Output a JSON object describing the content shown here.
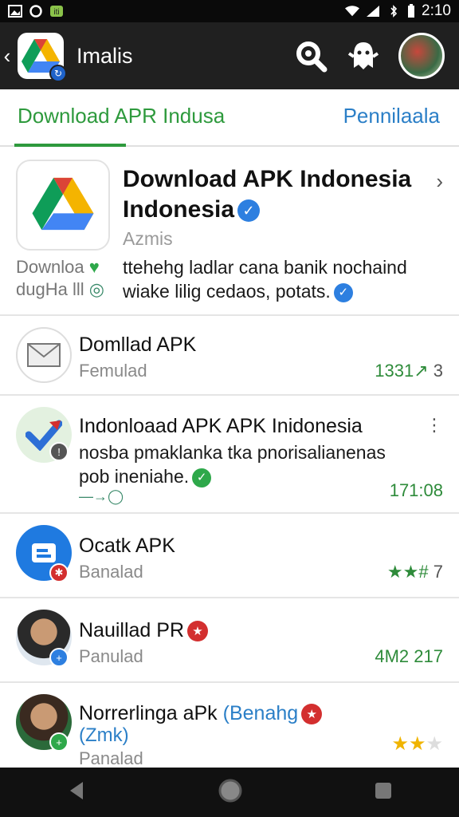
{
  "status": {
    "time": "2:10",
    "left_icons": [
      "image-icon",
      "data-saver-icon",
      "app-badge-icon"
    ],
    "right_icons": [
      "wifi-icon",
      "signal-icon",
      "bluetooth-icon",
      "battery-icon"
    ]
  },
  "appbar": {
    "title": "Imalis",
    "actions": [
      "search-icon",
      "ghost-icon",
      "avatar"
    ]
  },
  "tabs": [
    {
      "label": "Download APR Indusa",
      "active": true
    },
    {
      "label": "Pennilaala",
      "active": false
    }
  ],
  "featured": {
    "title": "Download APK Indonesia Indonesia",
    "subtitle": "Azmis",
    "description": "ttehehg ladlar cana banik nochaind wiake lilig cedaos, potats.",
    "left_line1": "Downloa",
    "left_line2": "dugHa lll"
  },
  "rows": [
    {
      "title": "Domllad APK",
      "subtitle": "Femulad",
      "meta": "1331",
      "meta_extra": "3",
      "icon": "mail-icon"
    },
    {
      "title": "Indonloaad APK APK Inidonesia",
      "subtitle": "nosba pmaklanka tka pnorisalianenas pob ineniahe.",
      "meta": "171:08",
      "icon": "check-icon"
    },
    {
      "title": "Ocatk APK",
      "subtitle": "Banalad",
      "meta": "7",
      "icon": "document-icon"
    },
    {
      "title": "Nauillad PR",
      "subtitle": "Panulad",
      "meta": "4M2 217",
      "icon": "avatar"
    },
    {
      "title": "Norrerlinga aPk",
      "title_extra": "(Benahg",
      "title_line2": "(Zmk)",
      "subtitle": "Panalad",
      "icon": "avatar"
    }
  ],
  "colors": {
    "accent_green": "#2e9a3d",
    "accent_blue": "#2b7fc7",
    "appbar": "#202020"
  }
}
